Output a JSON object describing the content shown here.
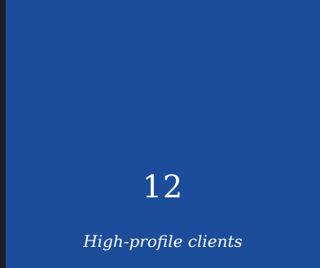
{
  "stat": {
    "value": "12",
    "label": "High-profile clients"
  },
  "colors": {
    "card_background": "#1b4d9a",
    "page_background": "#1e1f22",
    "text": "#ffffff"
  }
}
